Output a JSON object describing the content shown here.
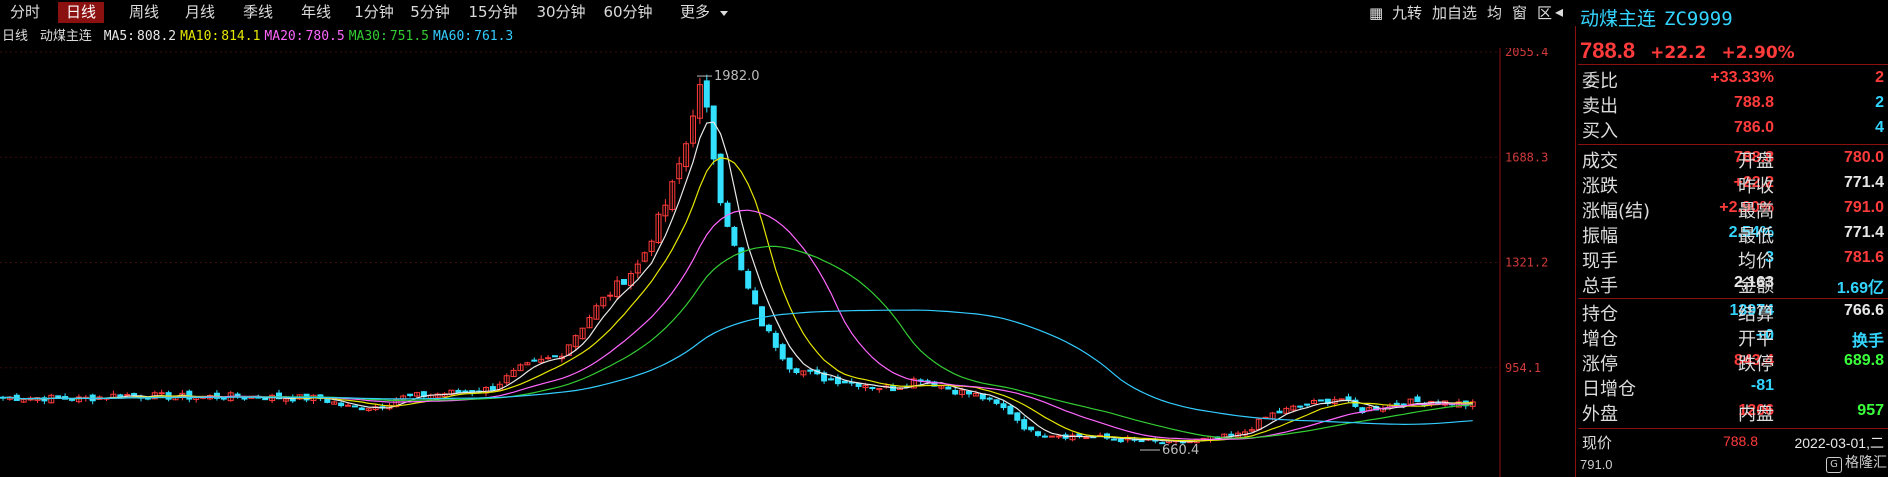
{
  "period_tabs": [
    {
      "label": "分时",
      "active": false
    },
    {
      "label": "日线",
      "active": true
    },
    {
      "label": "周线",
      "active": false
    },
    {
      "label": "月线",
      "active": false
    },
    {
      "label": "季线",
      "active": false
    },
    {
      "label": "年线",
      "active": false
    },
    {
      "label": "1分钟",
      "active": false
    },
    {
      "label": "5分钟",
      "active": false
    },
    {
      "label": "15分钟",
      "active": false
    },
    {
      "label": "30分钟",
      "active": false
    },
    {
      "label": "60分钟",
      "active": false
    },
    {
      "label": "更多",
      "active": false
    }
  ],
  "toolbar": {
    "items": [
      "九转",
      "加自选",
      "均",
      "窗",
      "区"
    ],
    "grid_icon": "grid-icon",
    "collapse_icon": "collapse-panel-icon"
  },
  "ma_bar": {
    "period": "日线",
    "name": "动煤主连",
    "items": [
      {
        "label": "MA5:",
        "value": "808.2",
        "color": "#e8e8e8"
      },
      {
        "label": "MA10:",
        "value": "814.1",
        "color": "#e6e600"
      },
      {
        "label": "MA20:",
        "value": "780.5",
        "color": "#ff66ff"
      },
      {
        "label": "MA30:",
        "value": "751.5",
        "color": "#33cc33"
      },
      {
        "label": "MA60:",
        "value": "761.3",
        "color": "#33ccff"
      }
    ]
  },
  "chart_data": {
    "type": "candlestick",
    "y_ticks": [
      "2055.4",
      "1688.3",
      "1321.2",
      "954.1"
    ],
    "annotations": [
      {
        "text": "1982.0",
        "kind": "high"
      },
      {
        "text": "660.4",
        "kind": "low"
      }
    ],
    "colors": {
      "up": "#ff3b3b",
      "down": "#33e0ff",
      "axis": "#8b1010",
      "ma5": "#e8e8e8",
      "ma10": "#e6e600",
      "ma20": "#ff66ff",
      "ma30": "#33cc33",
      "ma60": "#33ccff"
    },
    "ylim": [
      660.4,
      2055.4
    ]
  },
  "panel": {
    "name": "动煤主连",
    "code": "ZC9999",
    "price": "788.8",
    "change": "+22.2",
    "change_pct": "+2.90%",
    "order_rows": [
      {
        "label": "委比",
        "value": "+33.33%",
        "value_color": "red",
        "count": "2",
        "count_color": "red"
      },
      {
        "label": "卖出",
        "value": "788.8",
        "value_color": "red",
        "count": "2",
        "count_color": "cyan"
      },
      {
        "label": "买入",
        "value": "786.0",
        "value_color": "red",
        "count": "4",
        "count_color": "cyan"
      }
    ],
    "quote_rows": [
      {
        "l1": "成交",
        "v1": "788.8",
        "c1": "red",
        "l2": "开盘",
        "v2": "780.0",
        "c2": "red"
      },
      {
        "l1": "涨跌",
        "v1": "+22.2",
        "c1": "red",
        "l2": "昨收",
        "v2": "771.4",
        "c2": "white"
      },
      {
        "l1": "涨幅(结)",
        "v1": "+2.90%",
        "c1": "red",
        "l2": "最高",
        "v2": "791.0",
        "c2": "red"
      },
      {
        "l1": "振幅",
        "v1": "2.54%",
        "c1": "cyan",
        "l2": "最低",
        "v2": "771.4",
        "c2": "white"
      },
      {
        "l1": "现手",
        "v1": "3",
        "c1": "cyan",
        "l2": "均价",
        "v2": "781.6",
        "c2": "red"
      },
      {
        "l1": "总手",
        "v1": "2,163",
        "c1": "white",
        "l2": "金额",
        "v2": "1.69亿",
        "c2": "cyan"
      }
    ],
    "oi_rows": [
      {
        "l1": "持仓",
        "v1": "13974",
        "c1": "cyan",
        "l2": "结算",
        "v2": "766.6",
        "c2": "white"
      },
      {
        "l1": "增仓",
        "v1": "+0",
        "c1": "cyan",
        "l2": "开平",
        "v2": "换手",
        "c2": "cyan"
      },
      {
        "l1": "涨停",
        "v1": "843.4",
        "c1": "red",
        "l2": "跌停",
        "v2": "689.8",
        "c2": "green"
      },
      {
        "l1": "日增仓",
        "v1": "-81",
        "c1": "cyan",
        "l2": "",
        "v2": "",
        "c2": "white"
      },
      {
        "l1": "外盘",
        "v1": "1206",
        "c1": "red",
        "l2": "内盘",
        "v2": "957",
        "c2": "green"
      }
    ],
    "bottom": {
      "label": "现价",
      "value": "788.8",
      "date": "2022-03-01,二",
      "extra": "791.0"
    },
    "logo": {
      "mark": "G",
      "text": "格隆汇"
    }
  }
}
